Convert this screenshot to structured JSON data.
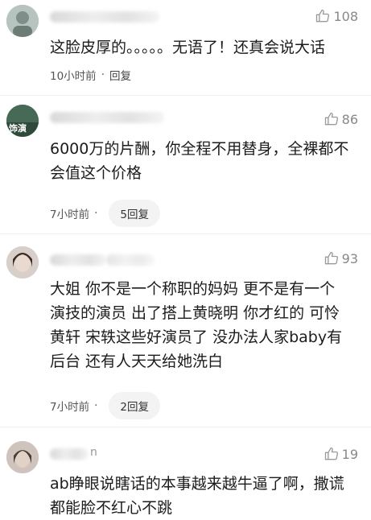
{
  "comments": [
    {
      "likes": "108",
      "text_lines": [
        "这脸皮厚的。。。。。无语了！还真会说大话"
      ],
      "time": "10小时前",
      "dot": "·",
      "reply": "回复",
      "colors": {
        "avatar": "#9aa7a2"
      }
    },
    {
      "likes": "86",
      "text_lines": [
        "6000万的片酬，你全程不用替身，全裸都不",
        "会值这个价格"
      ],
      "time": "7小时前",
      "dot": "·",
      "reply": "5回复",
      "avatar_text": "饰演",
      "colors": {
        "avatar": "#3f5b4c"
      }
    },
    {
      "likes": "93",
      "text_lines": [
        "大姐 你不是一个称职的妈妈 更不是有一个",
        "演技的演员 出了搭上黄晓明 你才红的 可怜",
        "黄轩 宋轶这些好演员了 没办法人家baby有",
        "后台 还有人天天给她洗白"
      ],
      "time": "7小时前",
      "dot": "·",
      "reply": "2回复",
      "colors": {
        "avatar": "#c9b7ad"
      }
    },
    {
      "likes": "19",
      "name_suffix": "n",
      "text_lines": [
        "ab睁眼说瞎话的本事越来越牛逼了啊，撒谎",
        "都能脸不红心不跳"
      ],
      "colors": {
        "avatar": "#b9a89d"
      }
    }
  ],
  "icons": {
    "like": "thumbs-up-icon"
  }
}
